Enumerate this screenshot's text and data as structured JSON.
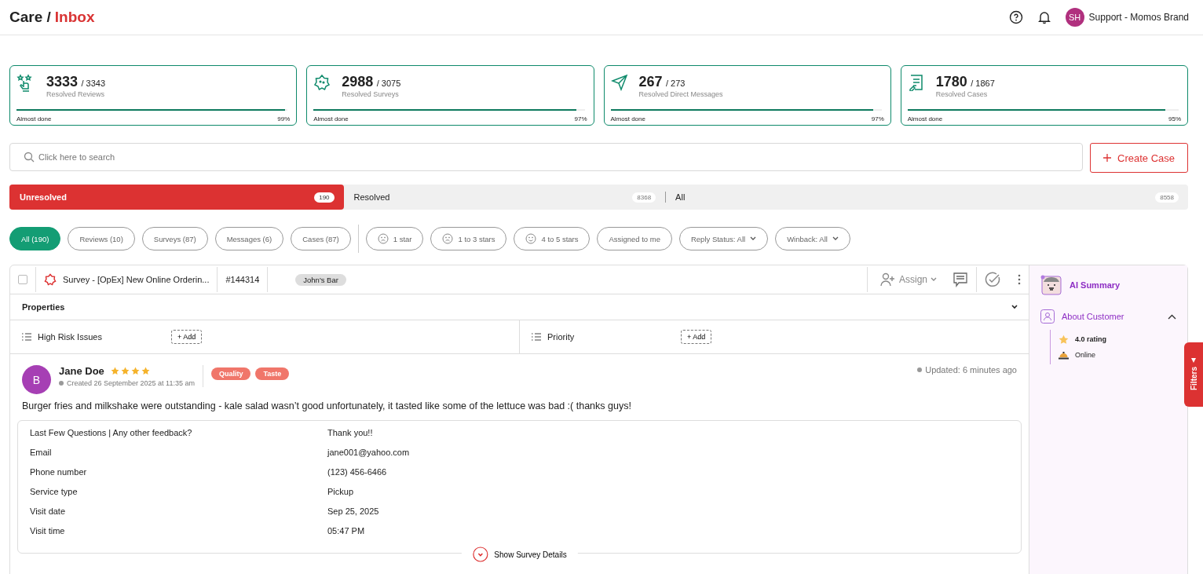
{
  "header": {
    "breadcrumb_root": "Care /",
    "breadcrumb_current": "Inbox",
    "user_initials": "SH",
    "user_name": "Support - Momos Brand"
  },
  "stats": [
    {
      "kind": "reviews",
      "value": "3333",
      "total": "/ 3343",
      "label": "Resolved Reviews",
      "status": "Almost done",
      "percent": "99%",
      "level": 0.99
    },
    {
      "kind": "surveys",
      "value": "2988",
      "total": "/ 3075",
      "label": "Resolved Surveys",
      "status": "Almost done",
      "percent": "97%",
      "level": 0.97
    },
    {
      "kind": "messages",
      "value": "267",
      "total": "/ 273",
      "label": "Resolved Direct Messages",
      "status": "Almost done",
      "percent": "97%",
      "level": 0.97
    },
    {
      "kind": "cases",
      "value": "1780",
      "total": "/ 1867",
      "label": "Resolved Cases",
      "status": "Almost done",
      "percent": "95%",
      "level": 0.95
    }
  ],
  "search": {
    "placeholder": "Click here to search"
  },
  "create_button": "Create Case",
  "tabs": [
    {
      "label": "Unresolved",
      "count": "190",
      "selected": true
    },
    {
      "label": "Resolved",
      "count": "8368",
      "selected": false
    },
    {
      "label": "All",
      "count": "8558",
      "selected": false
    }
  ],
  "chips": [
    {
      "kind": "plain",
      "label": "All (190)",
      "selected": true
    },
    {
      "kind": "plain",
      "label": "Reviews (10)",
      "selected": false
    },
    {
      "kind": "plain",
      "label": "Surveys (87)",
      "selected": false
    },
    {
      "kind": "plain",
      "label": "Messages (6)",
      "selected": false
    },
    {
      "kind": "plain",
      "label": "Cases (87)",
      "selected": false
    },
    {
      "kind": "divider"
    },
    {
      "kind": "sad",
      "label": "1 star",
      "selected": false
    },
    {
      "kind": "sad",
      "label": "1 to 3 stars",
      "selected": false
    },
    {
      "kind": "happy",
      "label": "4 to 5 stars",
      "selected": false
    },
    {
      "kind": "plain",
      "label": "Assigned to me",
      "selected": false
    },
    {
      "kind": "dropdown",
      "label": "Reply Status: All",
      "selected": false
    },
    {
      "kind": "dropdown",
      "label": "Winback: All",
      "selected": false
    }
  ],
  "case": {
    "checked": false,
    "title": "Survey - [OpEx] New Online Orderin...",
    "number": "#144314",
    "location": "John's Bar",
    "assign_label": "Assign",
    "properties_title": "Properties",
    "properties": [
      {
        "label": "High Risk Issues",
        "action": "+ Add"
      },
      {
        "label": "Priority",
        "action": "+ Add"
      }
    ],
    "author": {
      "initial": "B",
      "name": "Jane Doe",
      "stars": 4,
      "created": "Created 26 September 2025 at 11:35 am",
      "tags": [
        "Quality",
        "Taste"
      ],
      "updated": "Updated: 6 minutes ago"
    },
    "message": "Burger fries and milkshake were outstanding - kale salad wasn’t good unfortunately, it tasted like some of the lettuce was bad :( thanks guys!",
    "answers": [
      {
        "question": "Last Few Questions | Any other feedback?",
        "answer": "Thank you!!"
      },
      {
        "question": "Email",
        "answer": "jane001@yahoo.com"
      },
      {
        "question": "Phone number",
        "answer": "(123) 456-6466"
      },
      {
        "question": "Service type",
        "answer": "Pickup"
      },
      {
        "question": "Visit date",
        "answer": "Sep 25, 2025"
      },
      {
        "question": "Visit time",
        "answer": "05:47 PM"
      }
    ],
    "show_details": "Show Survey Details"
  },
  "side_panel": {
    "title": "AI Summary",
    "section": "About Customer",
    "expanded": true,
    "facts": [
      {
        "kind": "rating",
        "text": "4.0 rating"
      },
      {
        "kind": "channel",
        "text": "Online"
      }
    ]
  },
  "filters_tab": "Filters"
}
